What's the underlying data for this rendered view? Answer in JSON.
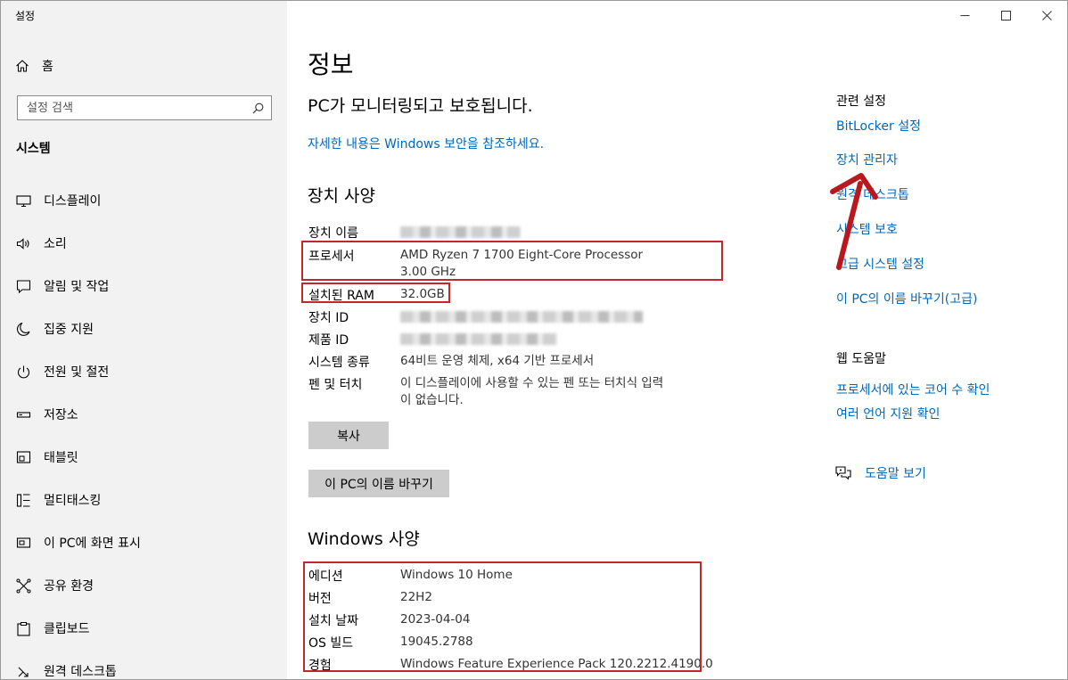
{
  "app_title": "설정",
  "sidebar": {
    "home_label": "홈",
    "search_placeholder": "설정 검색",
    "section_label": "시스템",
    "items": [
      {
        "label": "디스플레이",
        "icon": "monitor-icon"
      },
      {
        "label": "소리",
        "icon": "speaker-icon"
      },
      {
        "label": "알림 및 작업",
        "icon": "notification-icon"
      },
      {
        "label": "집중 지원",
        "icon": "moon-icon"
      },
      {
        "label": "전원 및 절전",
        "icon": "power-icon"
      },
      {
        "label": "저장소",
        "icon": "storage-icon"
      },
      {
        "label": "태블릿",
        "icon": "tablet-icon"
      },
      {
        "label": "멀티태스킹",
        "icon": "multitasking-icon"
      },
      {
        "label": "이 PC에 화면 표시",
        "icon": "project-icon"
      },
      {
        "label": "공유 환경",
        "icon": "share-icon"
      },
      {
        "label": "클립보드",
        "icon": "clipboard-icon"
      },
      {
        "label": "원격 데스크톱",
        "icon": "remote-desktop-icon"
      }
    ]
  },
  "main": {
    "title": "정보",
    "protect_text": "PC가 모니터링되고 보호됩니다.",
    "more_link": "자세한 내용은 Windows 보안을 참조하세요.",
    "device_spec": {
      "heading": "장치 사양",
      "device_name_label": "장치 이름",
      "processor_label": "프로세서",
      "processor_value_line1": "AMD Ryzen 7 1700 Eight-Core Processor",
      "processor_value_line2": "3.00 GHz",
      "ram_label": "설치된 RAM",
      "ram_value": "32.0GB",
      "device_id_label": "장치 ID",
      "product_id_label": "제품 ID",
      "system_type_label": "시스템 종류",
      "system_type_value": "64비트 운영 체제, x64 기반 프로세서",
      "pen_touch_label": "펜 및 터치",
      "pen_touch_value_line1": "이 디스플레이에 사용할 수 있는 펜 또는 터치식 입력",
      "pen_touch_value_line2": "이 없습니다."
    },
    "copy_button": "복사",
    "rename_button": "이 PC의 이름 바꾸기",
    "windows_spec": {
      "heading": "Windows 사양",
      "edition_label": "에디션",
      "edition_value": "Windows 10 Home",
      "version_label": "버전",
      "version_value": "22H2",
      "install_date_label": "설치 날짜",
      "install_date_value": "2023-04-04",
      "os_build_label": "OS 빌드",
      "os_build_value": "19045.2788",
      "experience_label": "경험",
      "experience_value": "Windows Feature Experience Pack 120.2212.4190.0"
    }
  },
  "right_panel": {
    "related_heading": "관련 설정",
    "bitlocker_link": "BitLocker 설정",
    "device_manager_link": "장치 관리자",
    "remote_desktop_link": "원격 데스크톱",
    "system_protection_link": "시스템 보호",
    "advanced_link": "고급 시스템 설정",
    "rename_advanced_link": "이 PC의 이름 바꾸기(고급)",
    "web_help_heading": "웹 도움말",
    "processor_check_link": "프로세서에 있는 코어 수 확인",
    "language_check_link": "여러 언어 지원 확인",
    "help_link": "도움말 보기"
  },
  "colors": {
    "accent": "#0067b8",
    "highlight_box": "#c0282d",
    "sidebar_bg": "#f2f2f2",
    "button_bg": "#cccccc"
  }
}
